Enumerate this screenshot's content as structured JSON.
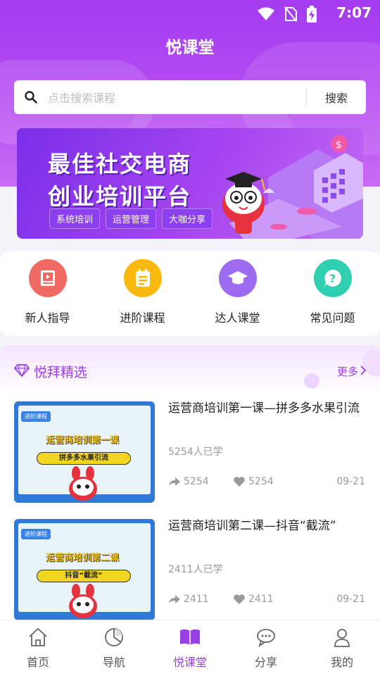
{
  "status_bar": {
    "time": "7:07"
  },
  "header": {
    "title": "悦课堂"
  },
  "search": {
    "placeholder": "点击搜索课程",
    "button_label": "搜索"
  },
  "banner": {
    "line1": "最佳社交电商",
    "line2": "创业培训平台",
    "tags": [
      "系统培训",
      "运营管理",
      "大咖分享"
    ]
  },
  "quick_menu": [
    {
      "label": "新人指导",
      "icon": "book-play-icon",
      "color": "#f06a63"
    },
    {
      "label": "进阶课程",
      "icon": "notepad-icon",
      "color": "#f9b90f"
    },
    {
      "label": "达人课堂",
      "icon": "graduation-cap-icon",
      "color": "#9b6cf0"
    },
    {
      "label": "常见问题",
      "icon": "question-bubble-icon",
      "color": "#2fcfb2"
    }
  ],
  "featured": {
    "title": "悦拜精选",
    "more_label": "更多",
    "courses": [
      {
        "title": "运营商培训第一课—拼多多水果引流",
        "learned": "5254人已学",
        "shares": "5254",
        "likes": "5254",
        "date": "09-21",
        "thumb_badge": "进阶课程",
        "thumb_title": "运营商培训第一课",
        "thumb_subtitle": "拼多多水果引流"
      },
      {
        "title": "运营商培训第二课—抖音“截流”",
        "learned": "2411人已学",
        "shares": "2411",
        "likes": "2411",
        "date": "09-21",
        "thumb_badge": "进阶课程",
        "thumb_title": "运营商培训第二课",
        "thumb_subtitle": "抖音“截流”"
      }
    ]
  },
  "tab_bar": {
    "tabs": [
      {
        "label": "首页",
        "icon": "home-icon"
      },
      {
        "label": "导航",
        "icon": "pie-chart-icon"
      },
      {
        "label": "悦课堂",
        "icon": "open-book-icon",
        "active": true
      },
      {
        "label": "分享",
        "icon": "chat-bubbles-icon"
      },
      {
        "label": "我的",
        "icon": "user-icon"
      }
    ]
  },
  "colors": {
    "accent": "#9a3fe6",
    "hero_top": "#a33cf0"
  }
}
